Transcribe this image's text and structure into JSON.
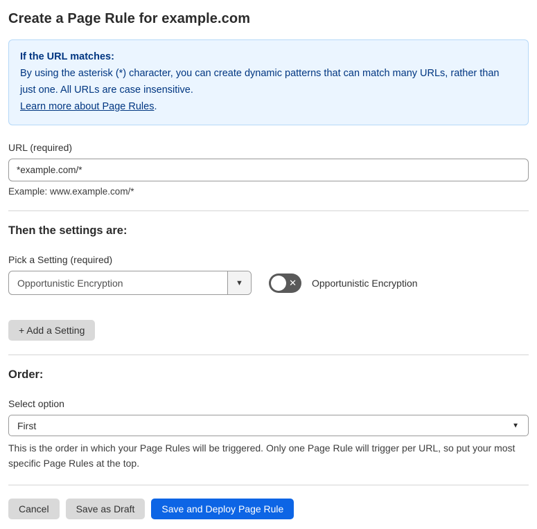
{
  "page": {
    "title": "Create a Page Rule for example.com"
  },
  "info_box": {
    "heading": "If the URL matches:",
    "body": "By using the asterisk (*) character, you can create dynamic patterns that can match many URLs, rather than just one. All URLs are case insensitive.",
    "link_label": "Learn more about Page Rules",
    "link_suffix": "."
  },
  "url_field": {
    "label": "URL (required)",
    "value": "*example.com/*",
    "helper": "Example: www.example.com/*"
  },
  "settings": {
    "heading": "Then the settings are:",
    "picker_label": "Pick a Setting (required)",
    "selected_setting": "Opportunistic Encryption",
    "toggle": {
      "state": "off",
      "label": "Opportunistic Encryption"
    },
    "add_button_label": "+ Add a Setting"
  },
  "order": {
    "heading": "Order:",
    "select_label": "Select option",
    "selected_option": "First",
    "helper": "This is the order in which your Page Rules will be triggered. Only one Page Rule will trigger per URL, so put your most specific Page Rules at the top."
  },
  "footer": {
    "cancel_label": "Cancel",
    "save_draft_label": "Save as Draft",
    "deploy_label": "Save and Deploy Page Rule"
  },
  "icons": {
    "dropdown_caret": "▼",
    "select_caret": "▼",
    "toggle_x": "✕"
  },
  "colors": {
    "accent_blue": "#0d65e5",
    "info_background": "#ebf5ff",
    "info_border": "#b5d8f8",
    "info_text": "#003681",
    "toggle_off_gray": "#595959",
    "button_gray": "#d9d9d9"
  }
}
